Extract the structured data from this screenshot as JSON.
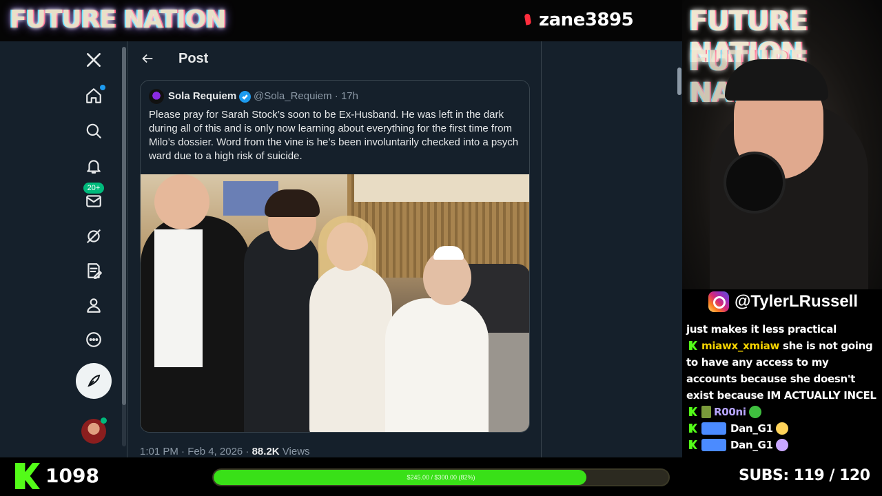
{
  "overlay": {
    "brand": "FUTURE NATION",
    "streamer_name": "zane3895",
    "instagram": "@TylerLRussell",
    "kick_followers": "1098",
    "goal_text": "$245.00 / $300.00 (82%)",
    "goal_fraction": 0.82,
    "subs_label": "SUBS:",
    "subs_value": "119 / 120",
    "colors": {
      "kick_green": "#53fc18",
      "goal_fill": "#39e018",
      "x_blue": "#1d9bf0"
    }
  },
  "x_app": {
    "nav": [
      {
        "name": "x-logo-icon"
      },
      {
        "name": "home-icon",
        "notify_dot": true
      },
      {
        "name": "search-icon"
      },
      {
        "name": "notifications-icon"
      },
      {
        "name": "messages-icon",
        "badge": "20+"
      },
      {
        "name": "grok-icon"
      },
      {
        "name": "lists-icon"
      },
      {
        "name": "profile-icon"
      },
      {
        "name": "more-icon"
      }
    ],
    "header": {
      "title": "Post"
    },
    "quoted_post": {
      "display_name": "Sola Requiem",
      "handle_time": "@Sola_Requiem · 17h",
      "text": "Please pray for Sarah Stock’s soon to be Ex-Husband. He was left in the dark during all of this and is only now learning about everything for the first time from Milo’s dossier. Word from the vine is he’s been involuntarily checked into a psych ward due to a high risk of suicide."
    },
    "post_meta": {
      "timestamp": "1:01 PM · Feb 4, 2026 · ",
      "views_count": "88.2K",
      "views_label": " Views"
    }
  },
  "chat": {
    "messages": [
      {
        "user": "",
        "text": "just makes it less practical"
      },
      {
        "user": "miawx_xmiaw",
        "text": " she is not going to have any access to my accounts because she doesn't exist because IM ACTUALLY INCEL"
      },
      {
        "user": "R00ni",
        "text": ""
      },
      {
        "user": "Dan_G1",
        "text": ""
      },
      {
        "user": "Dan_G1",
        "text": ""
      }
    ]
  }
}
